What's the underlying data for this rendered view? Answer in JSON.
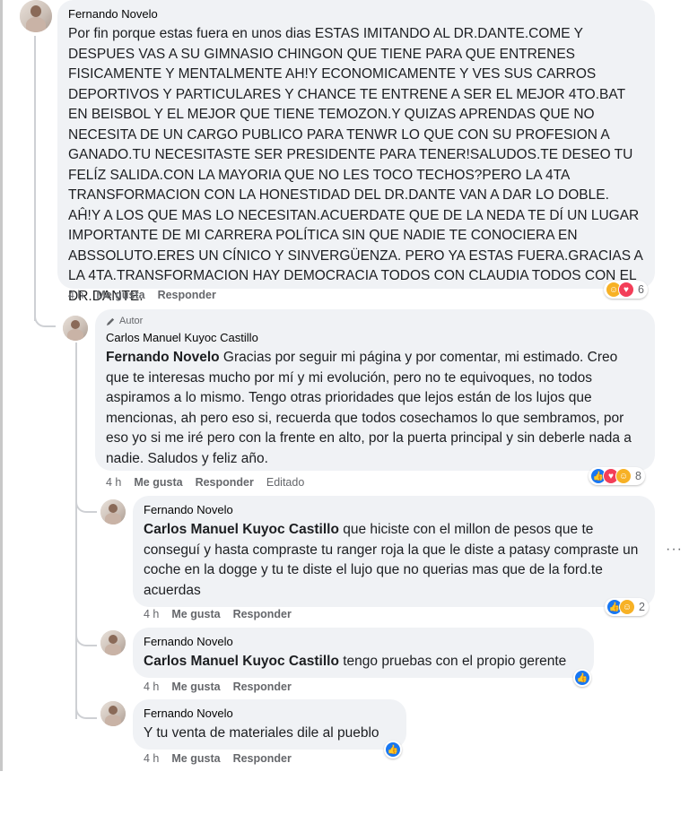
{
  "comments": [
    {
      "author": "Fernando Novelo",
      "text": "Por fin porque estas fuera en unos dias ESTAS IMITANDO AL DR.DANTE.COME Y DESPUES VAS A SU GIMNASIO CHINGON QUE TIENE PARA QUE ENTRENES FISICAMENTE Y MENTALMENTE AH!Y ECONOMICAMENTE Y VES SUS CARROS DEPORTIVOS Y PARTICULARES Y CHANCE TE ENTRENE A SER EL MEJOR 4TO.BAT EN BEISBOL Y EL MEJOR QUE TIENE TEMOZON.Y QUIZAS APRENDAS QUE NO NECESITA DE UN CARGO PUBLICO PARA TENWR LO QUE CON SU PROFESION A GANADO.TU NECESITASTE SER PRESIDENTE PARA TENER!SALUDOS.TE DESEO TU FELÍZ SALIDA.CON LA MAYORIA QUE NO LES TOCO TECHOS?PERO LA 4TA TRANSFORMACION CON LA HONESTIDAD DEL DR.DANTE VAN A DAR LO DOBLE. AĤ!Y A LOS QUE MAS LO NECESITAN.ACUERDATE QUE DE LA NEDA TE DÍ UN LUGAR IMPORTANTE DE MI CARRERA POLÍTICA SIN QUE NADIE TE CONOCIERA EN ABSSOLUTO.ERES UN CÍNICO Y SINVERGÜENZA. PERO YA ESTAS FUERA.GRACIAS A LA 4TA.TRANSFORMACION HAY DEMOCRACIA TODOS CON CLAUDIA TODOS CON EL DR.DANTE.",
      "time": "4 h",
      "like": "Me gusta",
      "reply": "Responder",
      "reaction_count": "6"
    },
    {
      "badge": "Autor",
      "author": "Carlos Manuel Kuyoc Castillo",
      "mention": "Fernando Novelo",
      "text": " Gracias por seguir mi página y por comentar, mi estimado. Creo que te interesas mucho por mí y mi evolución, pero no te equivoques, no todos aspiramos a lo mismo. Tengo otras prioridades que lejos están de los lujos que mencionas, ah pero eso si, recuerda que todos cosechamos lo que sembramos, por eso yo si me iré pero con la frente en alto, por la puerta principal y sin deberle nada a nadie. Saludos y feliz año.",
      "time": "4 h",
      "like": "Me gusta",
      "reply": "Responder",
      "edited": "Editado",
      "reaction_count": "8"
    },
    {
      "author": "Fernando Novelo",
      "mention": "Carlos Manuel Kuyoc Castillo",
      "text": " que hiciste con el millon de pesos que te conseguí y hasta compraste tu ranger roja la que le diste a patasy compraste un coche en la dogge y tu te diste el lujo que no querias mas que de la ford.te acuerdas",
      "time": "4 h",
      "like": "Me gusta",
      "reply": "Responder",
      "reaction_count": "2"
    },
    {
      "author": "Fernando Novelo",
      "mention": "Carlos Manuel Kuyoc Castillo",
      "text": " tengo pruebas con el propio gerente",
      "time": "4 h",
      "like": "Me gusta",
      "reply": "Responder"
    },
    {
      "author": "Fernando Novelo",
      "text": "Y tu venta de materiales dile al pueblo",
      "time": "4 h",
      "like": "Me gusta",
      "reply": "Responder"
    }
  ],
  "icons": {
    "like": "like-icon",
    "haha": "haha-icon",
    "love": "love-icon",
    "pencil": "pencil-icon",
    "more": "more-options-icon"
  },
  "colors": {
    "bubble": "#f0f2f5",
    "like": "#1877f2",
    "haha": "#f7b125",
    "love": "#f33e58",
    "meta": "#65676b"
  }
}
